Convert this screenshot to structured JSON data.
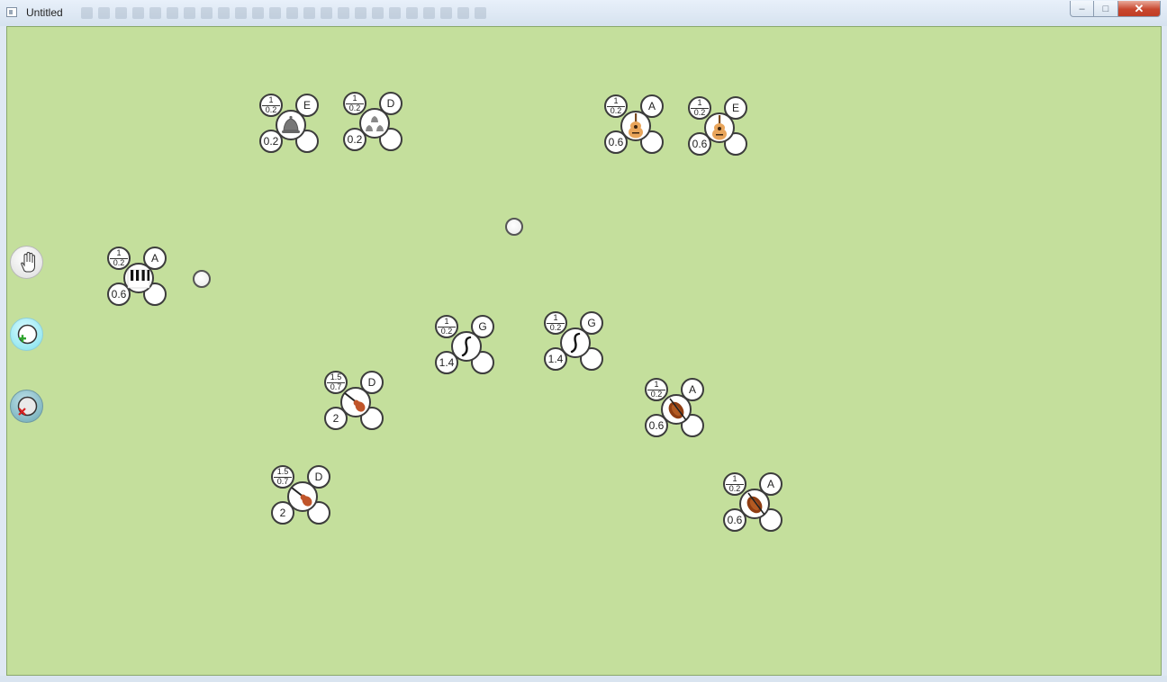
{
  "window": {
    "title": "Untitled",
    "minimize_icon": "minimize-icon",
    "maximize_icon": "maximize-icon",
    "close_icon": "close-icon"
  },
  "colors": {
    "canvas": "#c4df9c",
    "titlebar": "#dfe8f3",
    "bubble_border": "#3c3c3c"
  },
  "tools": [
    {
      "name": "hand-tool",
      "icon": "hand-icon"
    },
    {
      "name": "add-node-tool",
      "icon": "add-node-icon"
    },
    {
      "name": "delete-node-tool",
      "icon": "delete-node-icon"
    }
  ],
  "nodes": [
    {
      "instrument": "bell-icon",
      "ratio_num": "1",
      "ratio_den": "0.2",
      "note": "E",
      "volume": "0.2"
    },
    {
      "instrument": "chimes-icon",
      "ratio_num": "1",
      "ratio_den": "0.2",
      "note": "D",
      "volume": "0.2"
    },
    {
      "instrument": "guitar-icon",
      "ratio_num": "1",
      "ratio_den": "0.2",
      "note": "A",
      "volume": "0.6"
    },
    {
      "instrument": "guitar-icon",
      "ratio_num": "1",
      "ratio_den": "0.2",
      "note": "E",
      "volume": "0.6"
    },
    {
      "instrument": "piano-icon",
      "ratio_num": "1",
      "ratio_den": "0.2",
      "note": "A",
      "volume": "0.6"
    },
    {
      "instrument": "harp-icon",
      "ratio_num": "1",
      "ratio_den": "0.2",
      "note": "G",
      "volume": "1.4"
    },
    {
      "instrument": "harp-icon",
      "ratio_num": "1",
      "ratio_den": "0.2",
      "note": "G",
      "volume": "1.4"
    },
    {
      "instrument": "violin-icon",
      "ratio_num": "1.5",
      "ratio_den": "0.7",
      "note": "D",
      "volume": "2"
    },
    {
      "instrument": "cello-icon",
      "ratio_num": "1",
      "ratio_den": "0.2",
      "note": "A",
      "volume": "0.6"
    },
    {
      "instrument": "violin-icon",
      "ratio_num": "1.5",
      "ratio_den": "0.7",
      "note": "D",
      "volume": "2"
    },
    {
      "instrument": "cello-icon",
      "ratio_num": "1",
      "ratio_den": "0.2",
      "note": "A",
      "volume": "0.6"
    }
  ]
}
